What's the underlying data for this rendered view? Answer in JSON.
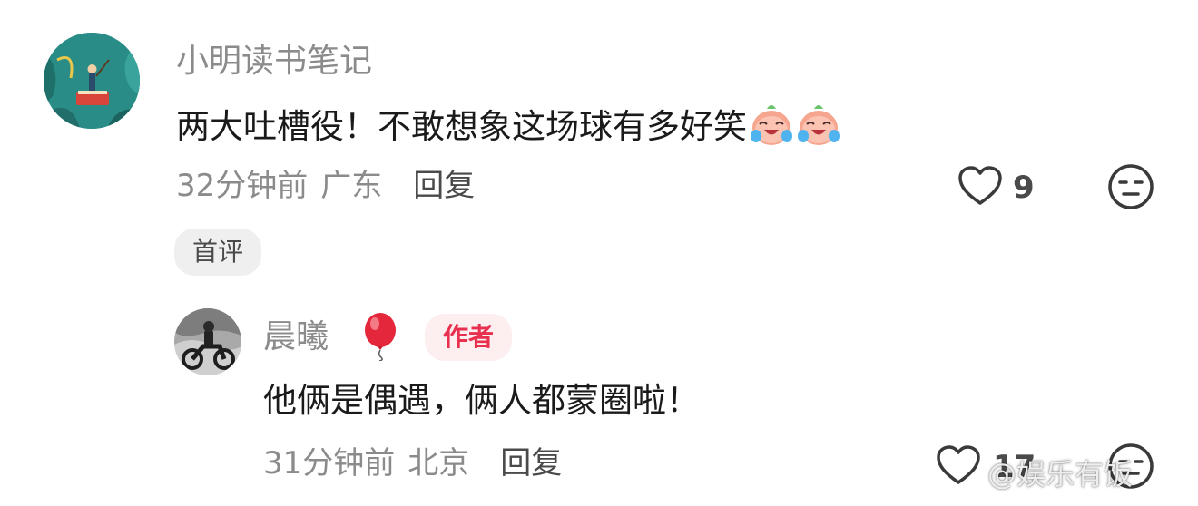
{
  "comment": {
    "username": "小明读书笔记",
    "text": "两大吐槽役！不敢想象这场球有多好笑",
    "emojis": [
      "laugh-cry-peach-emoji",
      "laugh-cry-peach-emoji"
    ],
    "time": "32分钟前",
    "location": "广东",
    "reply_label": "回复",
    "likes": "9",
    "badge": "首评"
  },
  "reply": {
    "username": "晨曦",
    "badge": "作者",
    "text": "他俩是偶遇，俩人都蒙圈啦！",
    "time": "31分钟前",
    "location": "北京",
    "reply_label": "回复",
    "likes": "17"
  },
  "watermark": "@娱乐有饭",
  "colors": {
    "meta_gray": "#8b8b8b",
    "author_red": "#e8314f",
    "author_bg": "#fdeef0",
    "badge_bg": "#efefef"
  }
}
